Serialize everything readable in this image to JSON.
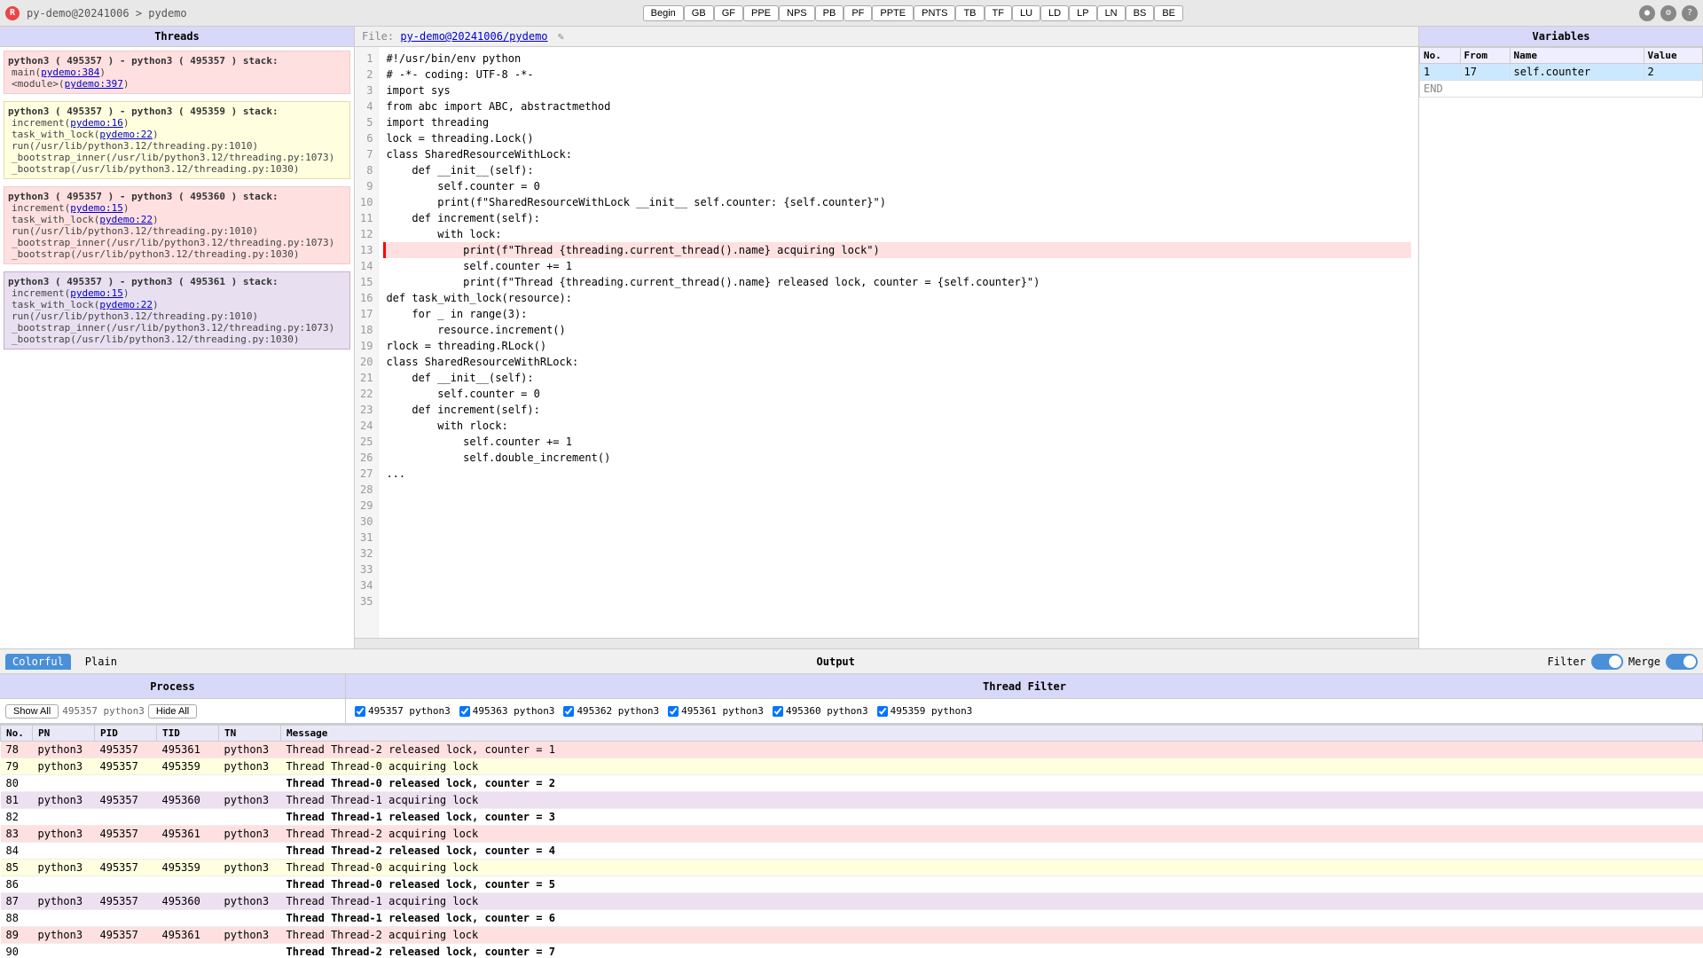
{
  "topbar": {
    "logo": "R",
    "breadcrumb_prefix": "py-demo@20241006",
    "breadcrumb_sep": " > ",
    "breadcrumb_project": "pydemo",
    "buttons": [
      "Begin",
      "GB",
      "GF",
      "PPE",
      "NPS",
      "PB",
      "PF",
      "PPTE",
      "PNTS",
      "TB",
      "TF",
      "LU",
      "LD",
      "LP",
      "LN",
      "BS",
      "BE"
    ]
  },
  "threads": {
    "header": "Threads",
    "blocks": [
      {
        "color": "pink",
        "title": "python3 ( 495357 ) - python3 ( 495357 ) stack:",
        "lines": [
          {
            "text": "main(pydemo:384)",
            "link": "pydemo:384"
          },
          {
            "text": "<module>(pydemo:397)",
            "link": "pydemo:397"
          }
        ]
      },
      {
        "color": "yellow",
        "title": "python3 ( 495357 ) - python3 ( 495359 ) stack:",
        "lines": [
          {
            "text": "increment(pydemo:16)",
            "link": "pydemo:16"
          },
          {
            "text": "task_with_lock(pydemo:22)",
            "link": "pydemo:22"
          },
          {
            "text": "run(/usr/lib/python3.12/threading.py:1010)",
            "link": null
          },
          {
            "text": "_bootstrap_inner(/usr/lib/python3.12/threading.py:1073)",
            "link": null
          },
          {
            "text": "_bootstrap(/usr/lib/python3.12/threading.py:1030)",
            "link": null
          }
        ]
      },
      {
        "color": "pink",
        "title": "python3 ( 495357 ) - python3 ( 495360 ) stack:",
        "lines": [
          {
            "text": "increment(pydemo:15)",
            "link": "pydemo:15"
          },
          {
            "text": "task_with_lock(pydemo:22)",
            "link": "pydemo:22"
          },
          {
            "text": "run(/usr/lib/python3.12/threading.py:1010)",
            "link": null
          },
          {
            "text": "_bootstrap_inner(/usr/lib/python3.12/threading.py:1073)",
            "link": null
          },
          {
            "text": "_bootstrap(/usr/lib/python3.12/threading.py:1030)",
            "link": null
          }
        ]
      },
      {
        "color": "lavender",
        "title": "python3 ( 495357 ) - python3 ( 495361 ) stack:",
        "lines": [
          {
            "text": "increment(pydemo:15)",
            "link": "pydemo:15"
          },
          {
            "text": "task_with_lock(pydemo:22)",
            "link": "pydemo:22"
          },
          {
            "text": "run(/usr/lib/python3.12/threading.py:1010)",
            "link": null
          },
          {
            "text": "_bootstrap_inner(/usr/lib/python3.12/threading.py:1073)",
            "link": null
          },
          {
            "text": "_bootstrap(/usr/lib/python3.12/threading.py:1030)",
            "link": null
          }
        ]
      }
    ]
  },
  "editor": {
    "header_label": "File:",
    "file_path": "py-demo@20241006/pydemo",
    "highlighted_line": 16
  },
  "variables": {
    "header": "Variables",
    "col_no": "No.",
    "col_from": "From",
    "col_name": "Name",
    "col_value": "Value",
    "rows": [
      {
        "no": "1",
        "from": "17",
        "name": "self.counter",
        "value": "2"
      }
    ],
    "end_label": "END"
  },
  "tabs": {
    "colorful_label": "Colorful",
    "plain_label": "Plain",
    "output_label": "Output",
    "filter_label": "Filter",
    "merge_label": "Merge"
  },
  "output": {
    "process_header": "Process",
    "thread_filter_header": "Thread Filter",
    "show_all": "Show All",
    "hide_all": "Hide All",
    "col_no": "No.",
    "col_pn": "PN",
    "col_pid": "PID",
    "col_tid": "TID",
    "col_tn": "TN",
    "col_message": "Message",
    "thread_filters": [
      {
        "checked": true,
        "label": "495357 python3"
      },
      {
        "checked": true,
        "label": "495363 python3"
      },
      {
        "checked": true,
        "label": "495362 python3"
      },
      {
        "checked": true,
        "label": "495361 python3"
      },
      {
        "checked": true,
        "label": "495360 python3"
      },
      {
        "checked": true,
        "label": "495359 python3"
      }
    ],
    "rows": [
      {
        "no": "78",
        "pn": "python3",
        "pid": "495357",
        "tid": "495361",
        "tn": "python3",
        "msg": "Thread Thread-2 released lock, counter = 1",
        "color": "pink"
      },
      {
        "no": "79",
        "pn": "python3",
        "pid": "495357",
        "tid": "495359",
        "tn": "python3",
        "msg": "Thread Thread-0 acquiring lock",
        "color": "yellow"
      },
      {
        "no": "80",
        "pn": "",
        "pid": "",
        "tid": "",
        "tn": "",
        "msg": "Thread Thread-0 released lock, counter = 2",
        "color": "white"
      },
      {
        "no": "81",
        "pn": "python3",
        "pid": "495357",
        "tid": "495360",
        "tn": "python3",
        "msg": "Thread Thread-1 acquiring lock",
        "color": "lavender"
      },
      {
        "no": "82",
        "pn": "",
        "pid": "",
        "tid": "",
        "tn": "",
        "msg": "Thread Thread-1 released lock, counter = 3",
        "color": "white"
      },
      {
        "no": "83",
        "pn": "python3",
        "pid": "495357",
        "tid": "495361",
        "tn": "python3",
        "msg": "Thread Thread-2 acquiring lock",
        "color": "pink"
      },
      {
        "no": "84",
        "pn": "",
        "pid": "",
        "tid": "",
        "tn": "",
        "msg": "Thread Thread-2 released lock, counter = 4",
        "color": "white"
      },
      {
        "no": "85",
        "pn": "python3",
        "pid": "495357",
        "tid": "495359",
        "tn": "python3",
        "msg": "Thread Thread-0 acquiring lock",
        "color": "yellow"
      },
      {
        "no": "86",
        "pn": "",
        "pid": "",
        "tid": "",
        "tn": "",
        "msg": "Thread Thread-0 released lock, counter = 5",
        "color": "white"
      },
      {
        "no": "87",
        "pn": "python3",
        "pid": "495357",
        "tid": "495360",
        "tn": "python3",
        "msg": "Thread Thread-1 acquiring lock",
        "color": "lavender"
      },
      {
        "no": "88",
        "pn": "",
        "pid": "",
        "tid": "",
        "tn": "",
        "msg": "Thread Thread-1 released lock, counter = 6",
        "color": "white"
      },
      {
        "no": "89",
        "pn": "python3",
        "pid": "495357",
        "tid": "495361",
        "tn": "python3",
        "msg": "Thread Thread-2 acquiring lock",
        "color": "pink"
      },
      {
        "no": "90",
        "pn": "",
        "pid": "",
        "tid": "",
        "tn": "",
        "msg": "Thread Thread-2 released lock, counter = 7",
        "color": "white"
      }
    ]
  },
  "colors": {
    "accent": "#4a90d9",
    "header_bg": "#d8d8f8"
  }
}
